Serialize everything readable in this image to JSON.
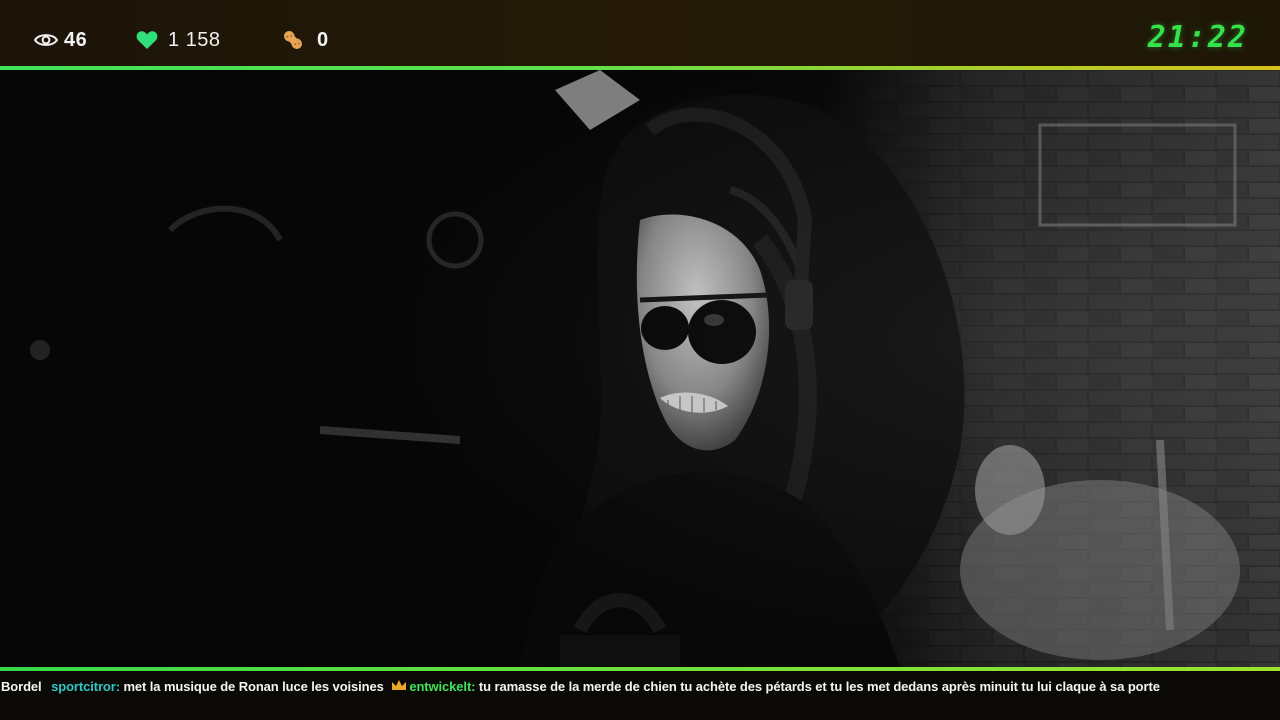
{
  "stats": {
    "viewers": {
      "icon": "eye-icon",
      "value": "46"
    },
    "likes": {
      "icon": "heart-icon",
      "value": "1 158"
    },
    "peanuts": {
      "icon": "peanut-icon",
      "value": "0"
    }
  },
  "clock": "21:22",
  "colors": {
    "accent_green": "#35e24b",
    "heart": "#2fe07a",
    "user_cyan": "#2ec6c6",
    "user_green": "#3ee35a",
    "crown": "#e8a92a",
    "topbar_bg": "#221907"
  },
  "ticker": {
    "messages": [
      {
        "user": "",
        "text": "Bordel"
      },
      {
        "user": "sportcitror:",
        "text": "met la musique de Ronan luce les voisines"
      },
      {
        "user": "entwickelt:",
        "badge": "crown-icon",
        "text": "tu ramasse de la merde de chien tu achète des pétards et tu les met dedans après minuit tu lui claque à sa porte"
      }
    ]
  }
}
